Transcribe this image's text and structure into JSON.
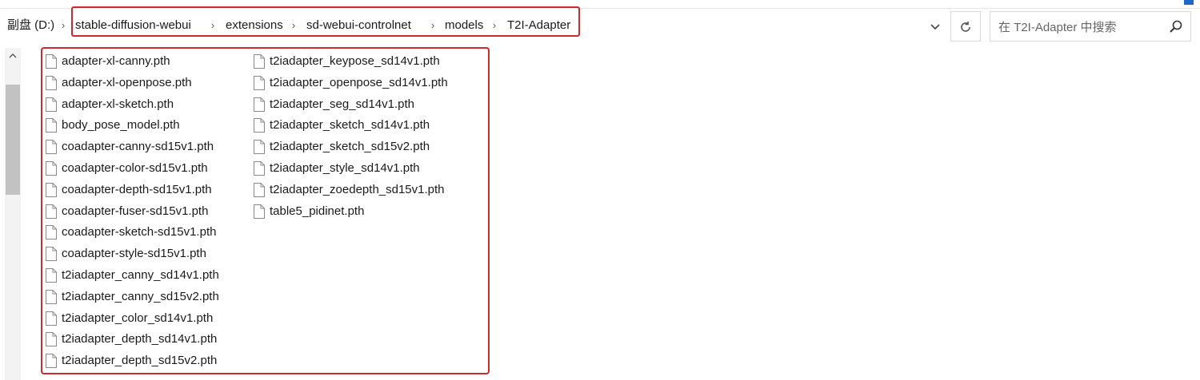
{
  "address": {
    "drive": "副盘 (D:)",
    "crumbs": [
      "stable-diffusion-webui",
      "extensions",
      "sd-webui-controlnet",
      "models",
      "T2I-Adapter"
    ],
    "separator": "›"
  },
  "search": {
    "placeholder": "在 T2I-Adapter 中搜索"
  },
  "icons": {
    "dropdown": "chevron-down-icon",
    "refresh": "refresh-icon",
    "search": "search-icon",
    "scroll_up": "scroll-up-arrow-icon",
    "file": "file-icon"
  },
  "colors": {
    "highlight": "#d0282c",
    "accent": "#1f66c9"
  },
  "files": {
    "column1": [
      "adapter-xl-canny.pth",
      "adapter-xl-openpose.pth",
      "adapter-xl-sketch.pth",
      "body_pose_model.pth",
      "coadapter-canny-sd15v1.pth",
      "coadapter-color-sd15v1.pth",
      "coadapter-depth-sd15v1.pth",
      "coadapter-fuser-sd15v1.pth",
      "coadapter-sketch-sd15v1.pth",
      "coadapter-style-sd15v1.pth",
      "t2iadapter_canny_sd14v1.pth",
      "t2iadapter_canny_sd15v2.pth",
      "t2iadapter_color_sd14v1.pth",
      "t2iadapter_depth_sd14v1.pth",
      "t2iadapter_depth_sd15v2.pth"
    ],
    "column2": [
      "t2iadapter_keypose_sd14v1.pth",
      "t2iadapter_openpose_sd14v1.pth",
      "t2iadapter_seg_sd14v1.pth",
      "t2iadapter_sketch_sd14v1.pth",
      "t2iadapter_sketch_sd15v2.pth",
      "t2iadapter_style_sd14v1.pth",
      "t2iadapter_zoedepth_sd15v1.pth",
      "table5_pidinet.pth"
    ]
  }
}
